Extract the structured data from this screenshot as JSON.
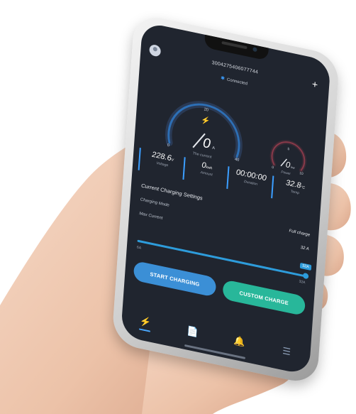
{
  "device": {
    "id": "3004275406077744",
    "status": "Connected",
    "status_icon": "bluetooth-icon"
  },
  "gauges": {
    "current": {
      "value": "0",
      "unit": "A",
      "label": "The current",
      "scale_min": "0",
      "scale_mid": "20",
      "scale_max": "40",
      "level": 0.0
    },
    "power": {
      "value": "0",
      "unit": "kw",
      "label": "Power",
      "scale_min": "0",
      "scale_mid": "5",
      "scale_max": "10",
      "level": 0.0
    }
  },
  "stats": [
    {
      "value": "228.6",
      "unit": "V",
      "label": "Voltage"
    },
    {
      "value": "0",
      "unit": "kwh",
      "label": "Amount"
    },
    {
      "value": "00:00:00",
      "unit": "",
      "label": "Duration"
    },
    {
      "value": "32.8",
      "unit": "°C",
      "label": "Temp"
    }
  ],
  "settings": {
    "title": "Current Charging Settings",
    "mode_label": "Charging Mode",
    "mode_value": "Full charge",
    "max_current_label": "Max Current",
    "max_current_value": "32 A",
    "slider": {
      "min_label": "6A",
      "max_label": "32A",
      "bubble": "32A",
      "fraction": 1.0
    }
  },
  "buttons": {
    "start": "START CHARGING",
    "custom": "CUSTOM CHARGE"
  },
  "nav": [
    {
      "icon": "lightning-icon",
      "active": true
    },
    {
      "icon": "document-icon",
      "active": false
    },
    {
      "icon": "bell-icon",
      "active": false
    },
    {
      "icon": "menu-icon",
      "active": false
    }
  ],
  "colors": {
    "screen_bg": "#20252f",
    "accent_blue": "#3b8fd6",
    "accent_green": "#28b79a",
    "gauge_blue": "#2d6fb5",
    "power_red": "#8a3a4a"
  }
}
